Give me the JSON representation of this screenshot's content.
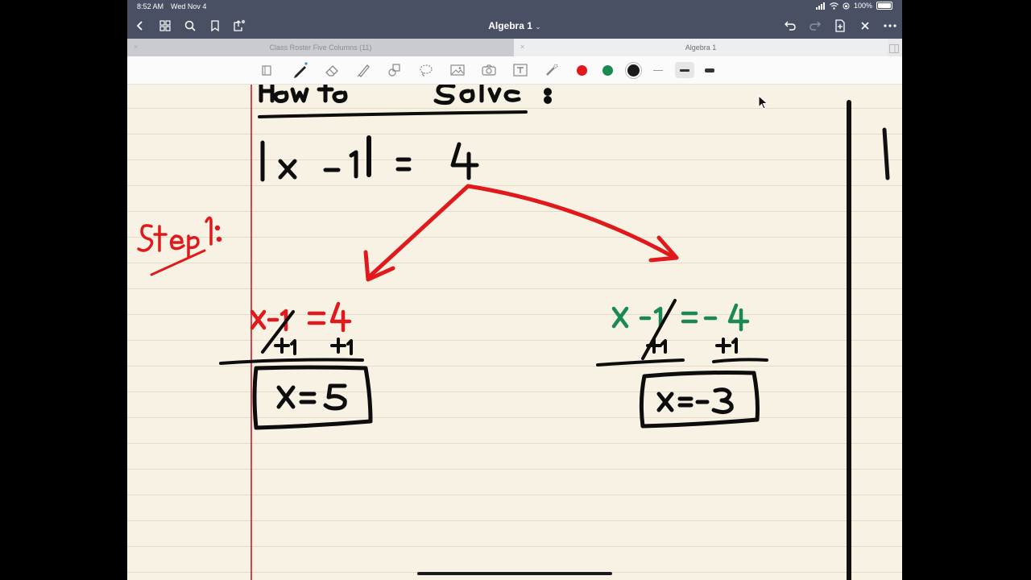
{
  "status": {
    "time": "8:52 AM",
    "date": "Wed Nov 4",
    "battery": "100%"
  },
  "nav": {
    "title": "Algebra 1",
    "title_chevron": "⌄"
  },
  "tabs": [
    {
      "label": "Class Roster Five Columns (11)",
      "close": "×",
      "active": false
    },
    {
      "label": "Algebra 1",
      "close": "×",
      "active": true
    }
  ],
  "toolbar": {
    "tools": [
      "lasso-select-icon",
      "pen-icon",
      "eraser-icon",
      "highlighter-icon",
      "shapes-icon",
      "lasso-icon",
      "image-icon",
      "camera-icon",
      "text-box-icon",
      "laser-pointer-icon"
    ],
    "colors": [
      "#e0191d",
      "#1a8a52",
      "#1a1a1a"
    ],
    "stroke_widths": [
      "thin",
      "medium",
      "thick"
    ]
  },
  "notes": {
    "heading": "How to Solve:",
    "equation": "|x − 1| = 4",
    "step_label": "Step 1:",
    "left_case": "x − 1 = 4",
    "left_work": "+1   +1",
    "left_answer": "x = 5",
    "right_case": "x − 1 = −4",
    "right_work": "+1   +1",
    "right_answer": "x = −3"
  },
  "colors": {
    "ink_black": "#0d0d0d",
    "ink_red": "#e0191d",
    "ink_green": "#1a8a52",
    "paper": "#f8f2e4",
    "chrome": "#4a5064"
  }
}
